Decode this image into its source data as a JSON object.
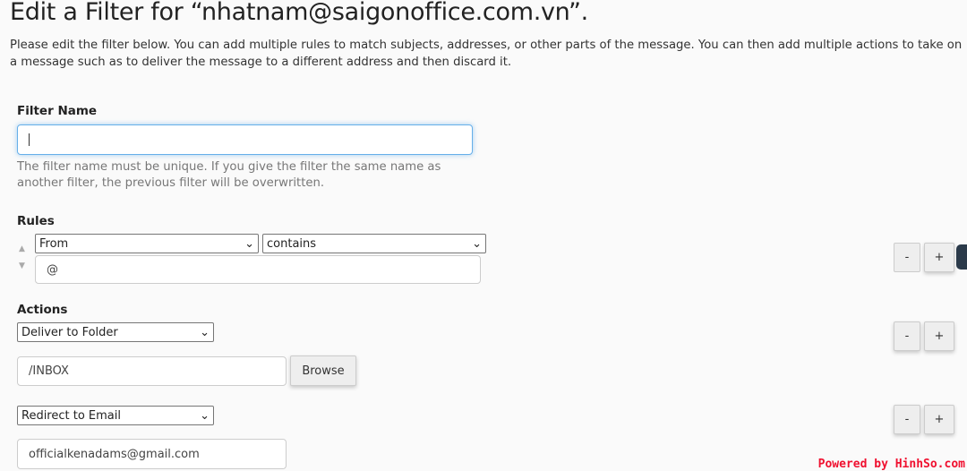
{
  "title": "Edit a Filter for “nhatnam@saigonoffice.com.vn”.",
  "description": "Please edit the filter below. You can add multiple rules to match subjects, addresses, or other parts of the message. You can then add multiple actions to take on a message such as to deliver the message to a different address and then discard it.",
  "filter_name": {
    "label": "Filter Name",
    "value": "",
    "help": "The filter name must be unique. If you give the filter the same name as another filter, the previous filter will be overwritten."
  },
  "rules": {
    "label": "Rules",
    "items": [
      {
        "field": "From",
        "operator": "contains",
        "value": "@"
      }
    ]
  },
  "actions": {
    "label": "Actions",
    "items": [
      {
        "type": "Deliver to Folder",
        "value": "/INBOX",
        "browse": "Browse"
      },
      {
        "type": "Redirect to Email",
        "value": "officialkenadams@gmail.com"
      }
    ]
  },
  "buttons": {
    "remove": "-",
    "add": "+"
  },
  "watermark": "Powered by HinhSo.com"
}
